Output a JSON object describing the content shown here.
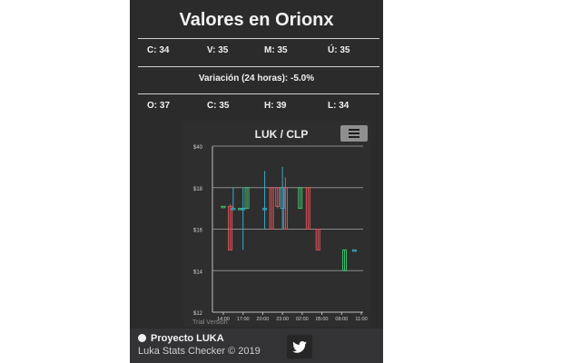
{
  "page": {
    "title": "Valores en Orionx",
    "stats_row1": [
      {
        "label": "C:",
        "value": "34"
      },
      {
        "label": "V:",
        "value": "35"
      },
      {
        "label": "M:",
        "value": "35"
      },
      {
        "label": "Ú:",
        "value": "35"
      }
    ],
    "variation": "Variación (24 horas): -5.0%",
    "stats_row2": [
      {
        "label": "O:",
        "value": "37"
      },
      {
        "label": "C:",
        "value": "35"
      },
      {
        "label": "H:",
        "value": "39"
      },
      {
        "label": "L:",
        "value": "34"
      }
    ]
  },
  "chart_data": {
    "type": "candlestick",
    "title": "LUK / CLP",
    "credit": "Trial Version",
    "menu_icon": "hamburger-icon",
    "y_ticks": [
      "$12",
      "$14",
      "$16",
      "$18",
      "$40"
    ],
    "y_values": [
      12,
      14,
      16,
      18,
      20
    ],
    "ylim": [
      12,
      20
    ],
    "x_ticks": [
      "14:00",
      "17:00",
      "20:00",
      "23:00",
      "02:00",
      "05:00",
      "08:00",
      "11:00"
    ],
    "colors": {
      "up": "#3fbf6c",
      "down": "#e0545a",
      "neutral": "#3aa8c8",
      "grid": "#8a8a8a",
      "axis": "#bdbdbd"
    },
    "candles": [
      {
        "x": 0.0,
        "open": 17.1,
        "close": 17.1,
        "high": 17.1,
        "low": 17.1,
        "dir": "up"
      },
      {
        "x": 0.35,
        "open": 17.1,
        "close": 15.0,
        "high": 17.2,
        "low": 15.0,
        "dir": "down"
      },
      {
        "x": 0.5,
        "open": 17.0,
        "close": 17.0,
        "high": 18.0,
        "low": 17.0,
        "dir": "neutral"
      },
      {
        "x": 0.85,
        "open": 17.0,
        "close": 17.0,
        "high": 17.0,
        "low": 17.0,
        "dir": "up"
      },
      {
        "x": 1.0,
        "open": 17.0,
        "close": 17.0,
        "high": 18.0,
        "low": 15.0,
        "dir": "neutral"
      },
      {
        "x": 1.2,
        "open": 17.0,
        "close": 18.0,
        "high": 18.0,
        "low": 17.0,
        "dir": "up"
      },
      {
        "x": 2.1,
        "open": 17.0,
        "close": 17.0,
        "high": 18.8,
        "low": 16.0,
        "dir": "neutral"
      },
      {
        "x": 2.45,
        "open": 18.0,
        "close": 16.0,
        "high": 18.0,
        "low": 16.0,
        "dir": "down"
      },
      {
        "x": 2.75,
        "open": 17.1,
        "close": 18.0,
        "high": 18.0,
        "low": 17.0,
        "dir": "down"
      },
      {
        "x": 3.0,
        "open": 17.0,
        "close": 18.0,
        "high": 19.0,
        "low": 16.0,
        "dir": "neutral"
      },
      {
        "x": 3.15,
        "open": 18.0,
        "close": 16.0,
        "high": 18.5,
        "low": 16.0,
        "dir": "down"
      },
      {
        "x": 3.9,
        "open": 18.0,
        "close": 17.0,
        "high": 18.0,
        "low": 17.0,
        "dir": "up"
      },
      {
        "x": 4.3,
        "open": 18.0,
        "close": 16.0,
        "high": 18.0,
        "low": 16.0,
        "dir": "down"
      },
      {
        "x": 4.8,
        "open": 16.0,
        "close": 15.0,
        "high": 16.0,
        "low": 15.0,
        "dir": "down"
      },
      {
        "x": 6.15,
        "open": 14.0,
        "close": 15.0,
        "high": 15.0,
        "low": 14.0,
        "dir": "up"
      },
      {
        "x": 6.65,
        "open": 15.0,
        "close": 15.0,
        "high": 15.0,
        "low": 15.0,
        "dir": "neutral"
      }
    ]
  },
  "footer": {
    "project_link": "Proyecto LUKA",
    "copyright": "Luka Stats Checker © 2019",
    "twitter_icon": "twitter-icon",
    "globe_icon": "globe-icon"
  }
}
